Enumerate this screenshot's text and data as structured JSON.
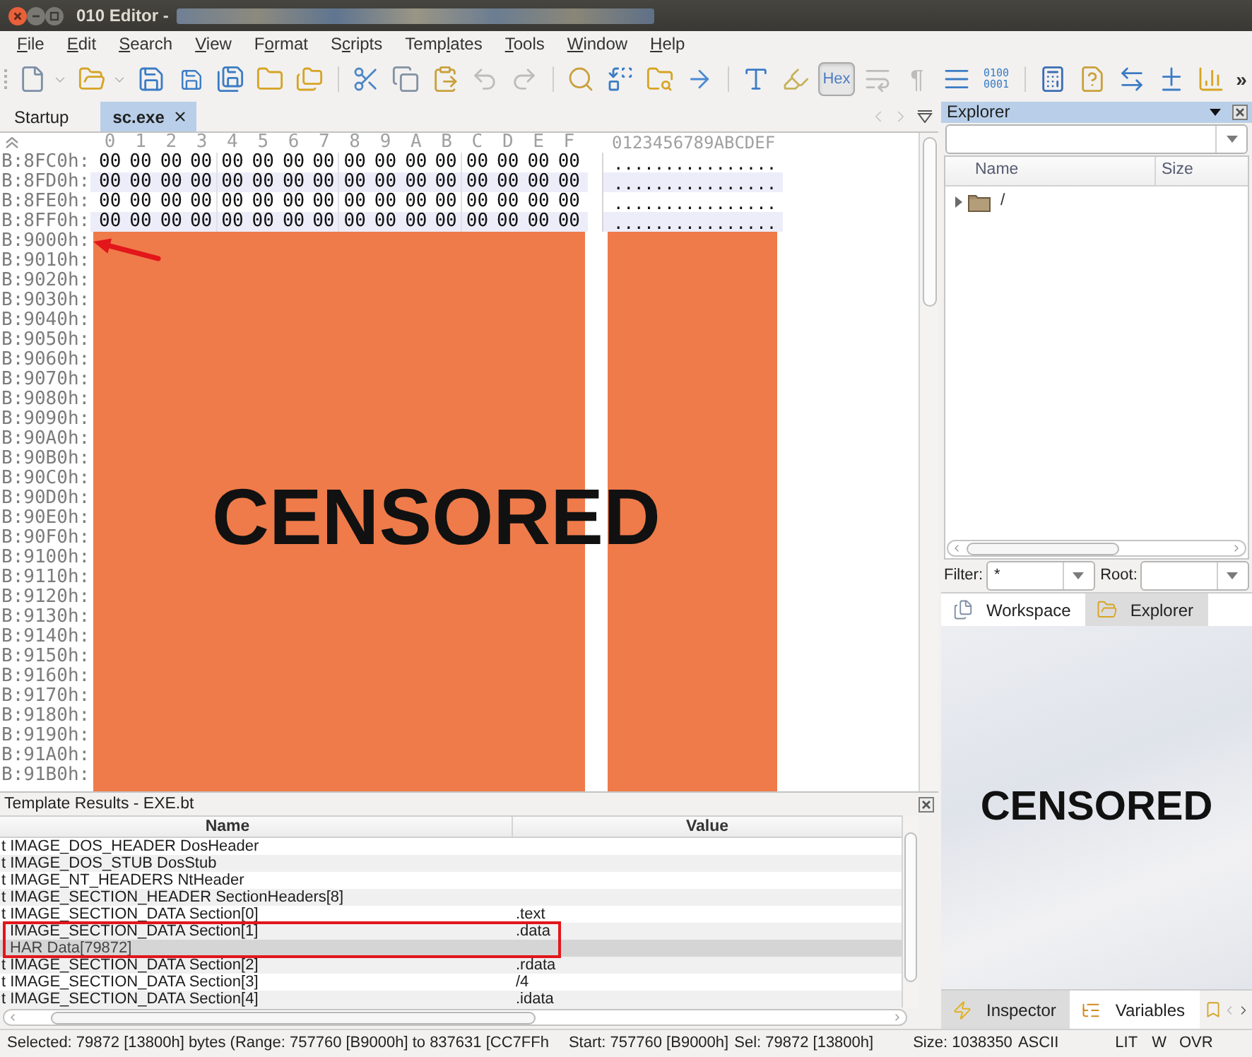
{
  "window": {
    "title": "010 Editor -",
    "title_redacted": true
  },
  "menu": [
    {
      "key": "F",
      "rest": "ile"
    },
    {
      "key": "E",
      "rest": "dit"
    },
    {
      "key": "S",
      "rest": "earch"
    },
    {
      "key": "V",
      "rest": "iew"
    },
    {
      "lead": "F",
      "key": "o",
      "rest": "rmat"
    },
    {
      "lead": "S",
      "key": "c",
      "rest": "ripts"
    },
    {
      "lead": "Temp",
      "key": "l",
      "rest": "ates"
    },
    {
      "key": "T",
      "rest": "ools"
    },
    {
      "key": "W",
      "rest": "indow"
    },
    {
      "key": "H",
      "rest": "elp"
    }
  ],
  "toolbar": {
    "groups": [
      {
        "items": [
          {
            "kind": "new",
            "disabled": false
          },
          {
            "kind": "open",
            "disabled": false
          },
          {
            "kind": "save",
            "disabled": false
          },
          {
            "kind": "save_as",
            "disabled": false
          },
          {
            "kind": "save_all",
            "disabled": false
          },
          {
            "kind": "folder",
            "disabled": false
          },
          {
            "kind": "folders",
            "disabled": false
          }
        ]
      },
      {
        "items": [
          {
            "kind": "cut",
            "disabled": false
          },
          {
            "kind": "copy",
            "disabled": false
          },
          {
            "kind": "paste",
            "disabled": false
          },
          {
            "kind": "undo",
            "disabled": true
          },
          {
            "kind": "redo",
            "disabled": true
          }
        ]
      },
      {
        "items": [
          {
            "kind": "find",
            "disabled": false
          },
          {
            "kind": "replace",
            "disabled": false
          },
          {
            "kind": "find_files",
            "disabled": false
          },
          {
            "kind": "goto",
            "disabled": false
          }
        ]
      },
      {
        "items": [
          {
            "kind": "font",
            "disabled": false
          },
          {
            "kind": "highlight",
            "disabled": false
          },
          {
            "kind": "toggle",
            "label": "Hex",
            "on": true,
            "disabled": false
          },
          {
            "kind": "wrap",
            "disabled": true
          },
          {
            "kind": "glyph",
            "label": "¶",
            "disabled": true
          },
          {
            "kind": "columns",
            "disabled": false
          },
          {
            "kind": "digits",
            "lines": [
              "0100",
              "0001"
            ],
            "disabled": false
          }
        ]
      },
      {
        "items": [
          {
            "kind": "calculator",
            "disabled": false
          },
          {
            "kind": "help",
            "disabled": false
          },
          {
            "kind": "swap",
            "disabled": false
          },
          {
            "kind": "plus_minus",
            "disabled": false
          },
          {
            "kind": "histogram",
            "disabled": false
          },
          {
            "kind": "overflow",
            "label": "»",
            "disabled": false
          }
        ]
      }
    ]
  },
  "document_tabs": [
    {
      "label": "Startup",
      "selected": false,
      "closable": false
    },
    {
      "label": "sc.exe",
      "selected": true,
      "closable": true
    }
  ],
  "hex_view": {
    "column_headers": [
      "0",
      "1",
      "2",
      "3",
      "4",
      "5",
      "6",
      "7",
      "8",
      "9",
      "A",
      "B",
      "C",
      "D",
      "E",
      "F"
    ],
    "ascii_header": "0123456789ABCDEF",
    "rows": [
      {
        "offset": "B:8FC0h:",
        "bytes": [
          "00",
          "00",
          "00",
          "00",
          "00",
          "00",
          "00",
          "00",
          "00",
          "00",
          "00",
          "00",
          "00",
          "00",
          "00",
          "00"
        ],
        "ascii": "................"
      },
      {
        "offset": "B:8FD0h:",
        "bytes": [
          "00",
          "00",
          "00",
          "00",
          "00",
          "00",
          "00",
          "00",
          "00",
          "00",
          "00",
          "00",
          "00",
          "00",
          "00",
          "00"
        ],
        "ascii": "................"
      },
      {
        "offset": "B:8FE0h:",
        "bytes": [
          "00",
          "00",
          "00",
          "00",
          "00",
          "00",
          "00",
          "00",
          "00",
          "00",
          "00",
          "00",
          "00",
          "00",
          "00",
          "00"
        ],
        "ascii": "................"
      },
      {
        "offset": "B:8FF0h:",
        "bytes": [
          "00",
          "00",
          "00",
          "00",
          "00",
          "00",
          "00",
          "00",
          "00",
          "00",
          "00",
          "00",
          "00",
          "00",
          "00",
          "00"
        ],
        "ascii": "................"
      },
      {
        "offset": "B:9000h:"
      },
      {
        "offset": "B:9010h:"
      },
      {
        "offset": "B:9020h:"
      },
      {
        "offset": "B:9030h:"
      },
      {
        "offset": "B:9040h:"
      },
      {
        "offset": "B:9050h:"
      },
      {
        "offset": "B:9060h:"
      },
      {
        "offset": "B:9070h:"
      },
      {
        "offset": "B:9080h:"
      },
      {
        "offset": "B:9090h:"
      },
      {
        "offset": "B:90A0h:"
      },
      {
        "offset": "B:90B0h:"
      },
      {
        "offset": "B:90C0h:"
      },
      {
        "offset": "B:90D0h:"
      },
      {
        "offset": "B:90E0h:"
      },
      {
        "offset": "B:90F0h:"
      },
      {
        "offset": "B:9100h:"
      },
      {
        "offset": "B:9110h:"
      },
      {
        "offset": "B:9120h:"
      },
      {
        "offset": "B:9130h:"
      },
      {
        "offset": "B:9140h:"
      },
      {
        "offset": "B:9150h:"
      },
      {
        "offset": "B:9160h:"
      },
      {
        "offset": "B:9170h:"
      },
      {
        "offset": "B:9180h:"
      },
      {
        "offset": "B:9190h:"
      },
      {
        "offset": "B:91A0h:"
      },
      {
        "offset": "B:91B0h:"
      }
    ],
    "redaction": {
      "label": "CENSORED"
    }
  },
  "template_results": {
    "title": "Template Results - EXE.bt",
    "columns": [
      "Name",
      "Value"
    ],
    "rows": [
      {
        "name": "t IMAGE_DOS_HEADER DosHeader",
        "selected": false,
        "framed": false
      },
      {
        "name": "t IMAGE_DOS_STUB DosStub",
        "selected": false,
        "framed": false
      },
      {
        "name": "t IMAGE_NT_HEADERS NtHeader",
        "selected": false,
        "framed": false
      },
      {
        "name": "t IMAGE_SECTION_HEADER SectionHeaders[8]",
        "selected": false,
        "framed": false
      },
      {
        "name": "t IMAGE_SECTION_DATA Section[0]",
        "value": ".text",
        "selected": false,
        "framed": false
      },
      {
        "name": "IMAGE_SECTION_DATA Section[1]",
        "value": ".data",
        "selected": false,
        "framed": true
      },
      {
        "name": "HAR Data[79872]",
        "selected": true,
        "framed": true
      },
      {
        "name": "t IMAGE_SECTION_DATA Section[2]",
        "value": ".rdata",
        "selected": false,
        "framed": false
      },
      {
        "name": "t IMAGE_SECTION_DATA Section[3]",
        "value": "/4",
        "selected": false,
        "framed": false
      },
      {
        "name": "t IMAGE_SECTION_DATA Section[4]",
        "value": ".idata",
        "selected": false,
        "framed": false
      }
    ]
  },
  "explorer": {
    "title": "Explorer",
    "columns": [
      "Name",
      "Size"
    ],
    "tree": [
      {
        "label": "/",
        "expanded": false
      }
    ],
    "filter": {
      "label": "Filter:",
      "value": "*"
    },
    "root": {
      "label": "Root:"
    },
    "tabs": [
      {
        "label": "Workspace",
        "selected": false
      },
      {
        "label": "Explorer",
        "selected": true
      }
    ]
  },
  "side_panel": {
    "redaction": {
      "label": "CENSORED"
    },
    "tabs": [
      {
        "label": "Inspector",
        "selected": true
      },
      {
        "label": "Variables",
        "selected": false
      }
    ]
  },
  "status_bar": {
    "items": [
      "Selected: 79872 [13800h] bytes (Range: 757760 [B9000h] to 837631 [CC7FFh",
      "Start: 757760 [B9000h]",
      "Sel: 79872 [13800h]",
      "Size: 1038350",
      "ASCII",
      "LIT",
      "W",
      "OVR"
    ]
  }
}
